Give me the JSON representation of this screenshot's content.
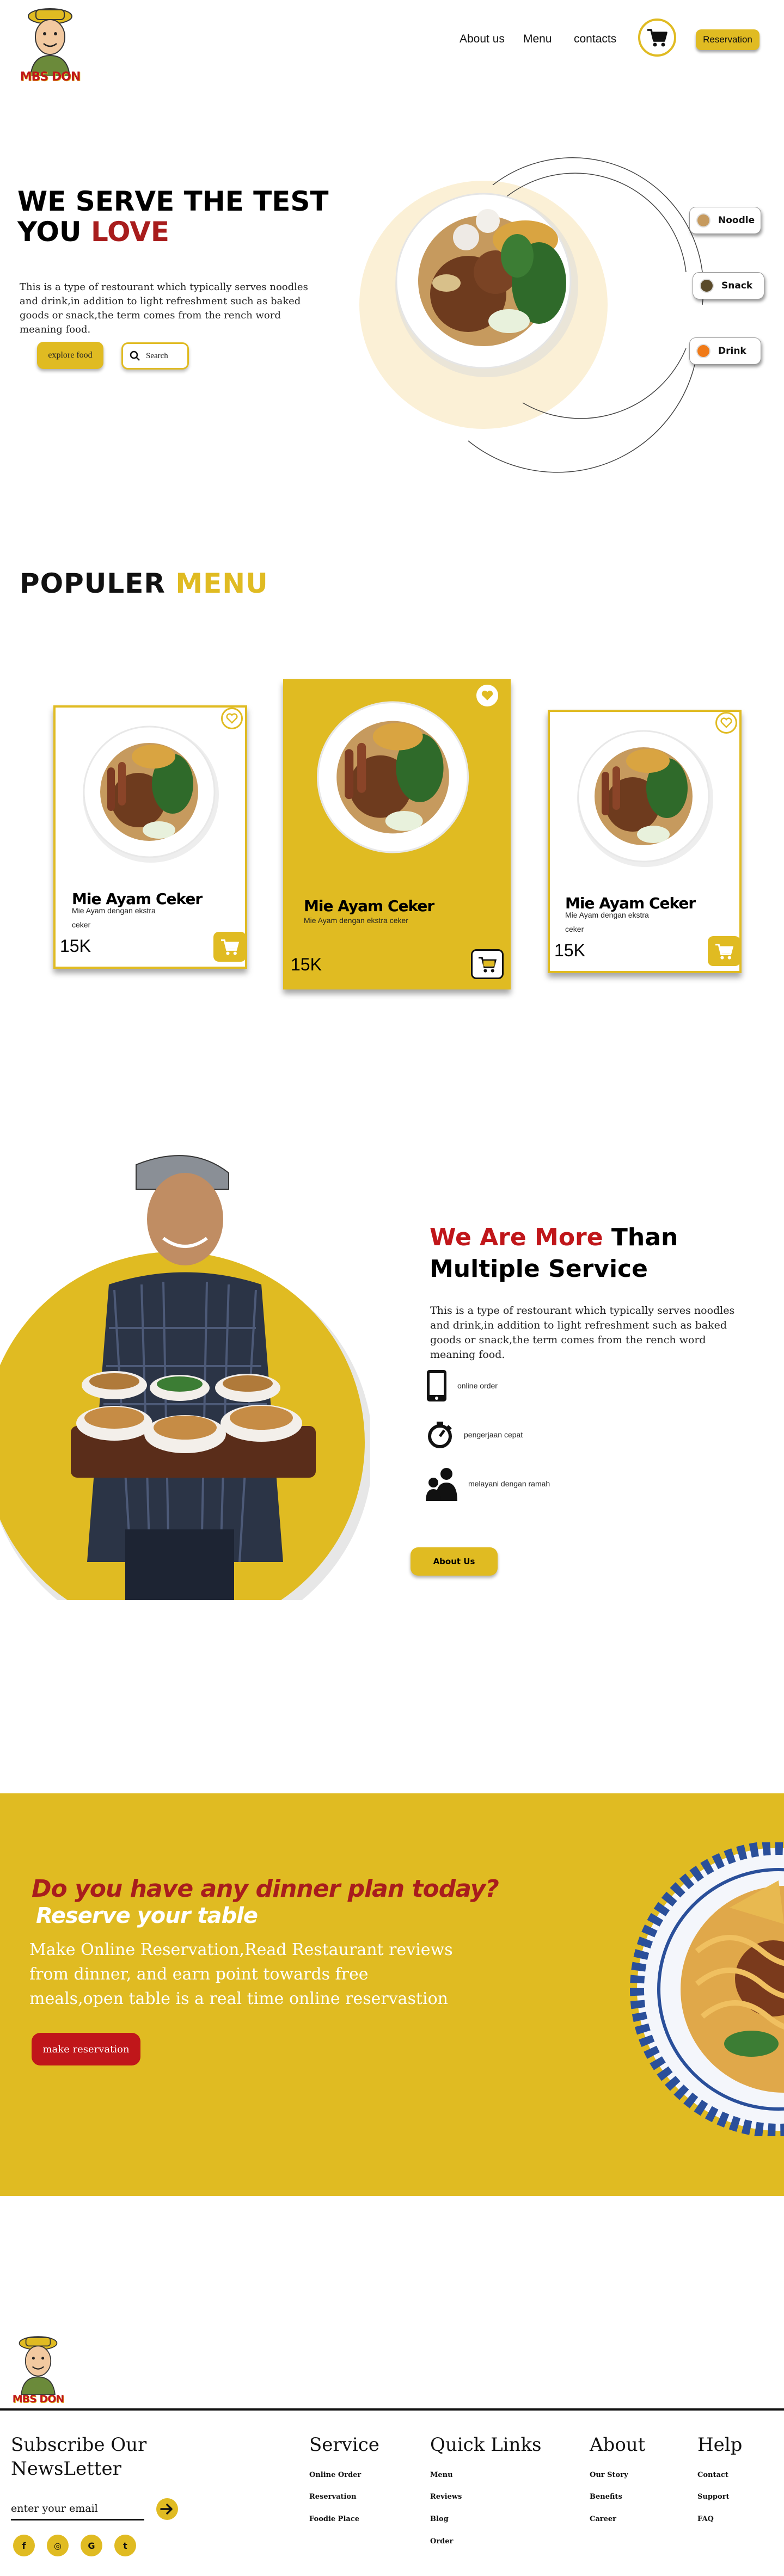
{
  "header": {
    "logo_text": "MBS DON",
    "nav": [
      {
        "label": "About us"
      },
      {
        "label": "Menu"
      },
      {
        "label": "contacts"
      }
    ],
    "reservation_label": "Reservation"
  },
  "hero": {
    "title_line1": "WE SERVE THE TEST",
    "title_line2_a": "YOU ",
    "title_line2_b": "LOVE",
    "description": "This is a type of restourant which typically serves noodles and drink,in addition to light refreshment such as baked goods or snack,the term comes from the rench word meaning food.",
    "explore_label": "explore food",
    "search_label": "Search",
    "categories": [
      {
        "label": "Noodle"
      },
      {
        "label": "Snack"
      },
      {
        "label": "Drink"
      }
    ]
  },
  "popular": {
    "title_a": "POPULER ",
    "title_b": "MENU",
    "cards": [
      {
        "name": "Mie Ayam Ceker",
        "desc_line1": "Mie Ayam dengan ekstra",
        "desc_line2": "ceker",
        "price": "15K"
      },
      {
        "name": "Mie Ayam Ceker",
        "desc_line1": "Mie Ayam dengan ekstra ceker",
        "desc_line2": "",
        "price": "15K"
      },
      {
        "name": "Mie Ayam Ceker",
        "desc_line1": "Mie Ayam dengan ekstra",
        "desc_line2": "ceker",
        "price": "15K"
      }
    ]
  },
  "services": {
    "title_red": "We Are More",
    "title_black1": " Than",
    "title_black2": "Multiple Service",
    "description": "This is a type of restourant which typically serves noodles and drink,in addition to light refreshment such as baked goods or snack,the term comes from the rench word meaning food.",
    "items": [
      {
        "label": "online order"
      },
      {
        "label": "pengerjaan cepat"
      },
      {
        "label": "melayani dengan ramah"
      }
    ],
    "about_label": "About Us"
  },
  "reservation": {
    "question": "Do you have any  dinner plan today?",
    "headline": "Reserve your table",
    "description": "Make Online Reservation,Read Restaurant reviews from dinner, and earn point towards free meals,open table is a real time online reservastion",
    "button_label": "make reservation"
  },
  "footer": {
    "logo_text": "MBS DON",
    "subscribe_line1": "Subscribe Our",
    "subscribe_line2": "NewsLetter",
    "email_label": "enter your email",
    "social": [
      {
        "glyph": "f",
        "icon": "facebook-icon"
      },
      {
        "glyph": "◎",
        "icon": "instagram-icon"
      },
      {
        "glyph": "G",
        "icon": "google-icon"
      },
      {
        "glyph": "t",
        "icon": "twitter-icon"
      }
    ],
    "columns": [
      {
        "heading": "Service",
        "links": [
          "Online Order",
          "Reservation",
          "Foodie Place"
        ]
      },
      {
        "heading": "Quick Links",
        "links": [
          "Menu",
          "Reviews",
          "Blog",
          "Order"
        ]
      },
      {
        "heading": "About",
        "links": [
          "Our Story",
          "Benefits",
          "Career"
        ]
      },
      {
        "heading": "Help",
        "links": [
          "Contact",
          "Support",
          "FAQ"
        ]
      }
    ]
  },
  "colors": {
    "accent_yellow": "#e0bb22",
    "accent_red": "#a81d1d",
    "cream": "#fbf0d6"
  }
}
